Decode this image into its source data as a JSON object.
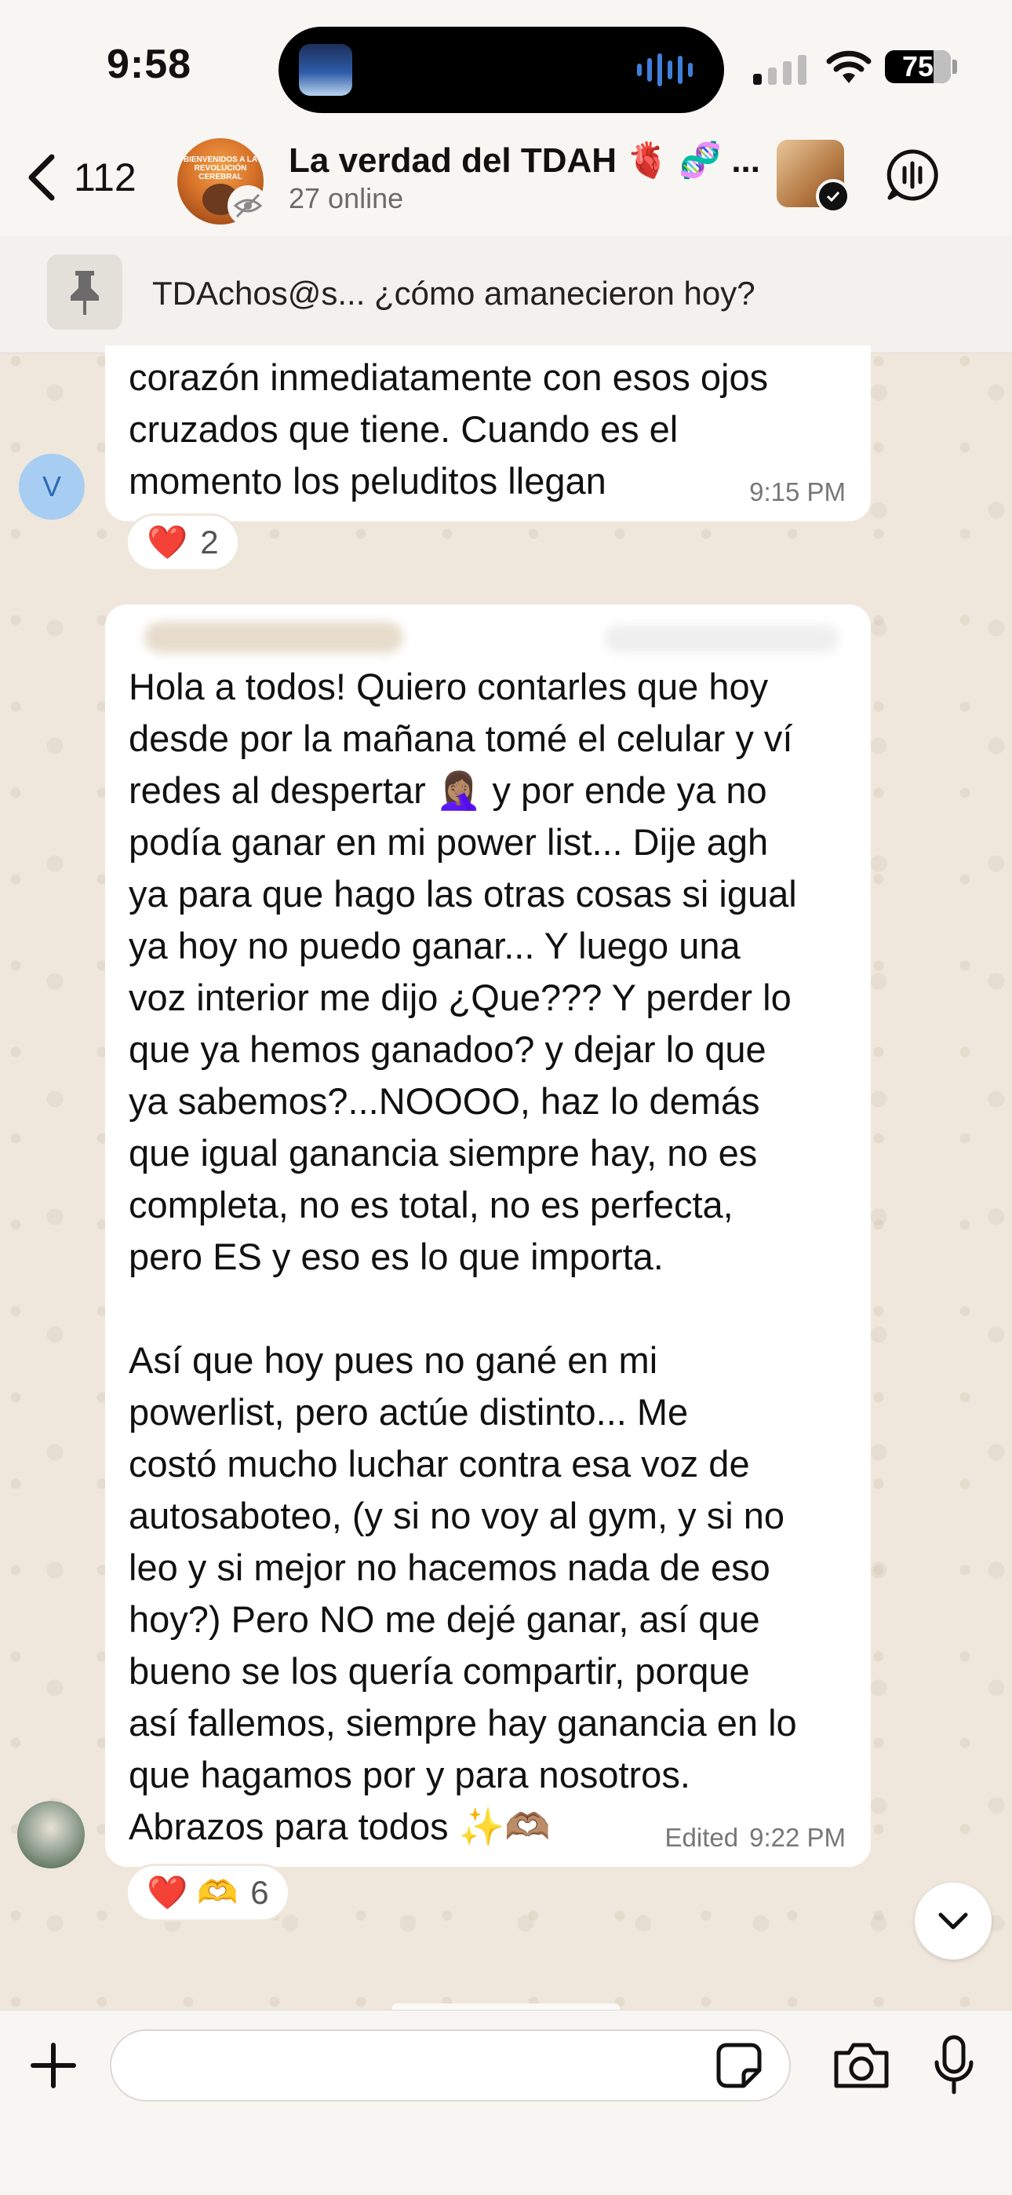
{
  "status_bar": {
    "time": "9:58",
    "battery": "75"
  },
  "header": {
    "back_count": "112",
    "group_name": "La verdad del TDAH 🫀 🧬 ...",
    "online": "27 online",
    "avatar_caption": "BIENVENIDOS A LA REVOLUCIÓN CEREBRAL"
  },
  "pinned": {
    "text": "TDAchos@s... ¿cómo amanecieron hoy?"
  },
  "messages": [
    {
      "sender_initial": "V",
      "text": "corazón inmediatamente con esos ojos\ncruzados que tiene. Cuando es el\nmomento los peluditos llegan",
      "time": "9:15 PM",
      "reactions": {
        "emoji": "❤️",
        "count": "2"
      }
    },
    {
      "text": "Hola a todos! Quiero contarles que hoy\ndesde por la mañana tomé el celular y ví\nredes al despertar 🤦🏽‍♀️ y por ende ya no\npodía ganar en mi power list... Dije agh\nya para que hago las otras cosas si igual\nya hoy no puedo ganar... Y luego una\nvoz interior me dijo ¿Que??? Y perder lo\nque ya hemos ganadoo? y dejar lo que\nya sabemos?...NOOOO, haz lo demás\nque igual ganancia siempre hay, no es\ncompleta, no es total, no es perfecta,\npero ES y eso es lo que importa.\n\nAsí que hoy pues no gané en mi\npowerlist, pero actúe distinto... Me\ncostó mucho luchar contra esa voz de\nautosaboteo, (y si no voy al gym, y si no\nleo y si mejor no hacemos nada de eso\nhoy?) Pero NO me dejé ganar, así que\nbueno se los quería compartir, porque\nasí fallemos, siempre hay ganancia en lo\nque hagamos por y para nosotros.\nAbrazos para todos ✨🫶🏽",
      "edited_label": "Edited",
      "time": "9:22 PM",
      "reactions": {
        "emoji": "❤️ 🫶",
        "count": "6"
      }
    }
  ],
  "input": {
    "placeholder": ""
  },
  "icons": {
    "back": "chevron-left-icon",
    "hidden": "eye-off-icon",
    "pin": "pin-icon",
    "ai": "meta-ai-icon",
    "scroll": "chevron-down-icon",
    "plus": "plus-icon",
    "sticker": "sticker-icon",
    "camera": "camera-icon",
    "mic": "microphone-icon"
  },
  "colors": {
    "accent": "#1a8cff",
    "bubble": "#ffffff",
    "wallpaper": "#efe7dc",
    "reaction_heart": "#e0242b"
  }
}
